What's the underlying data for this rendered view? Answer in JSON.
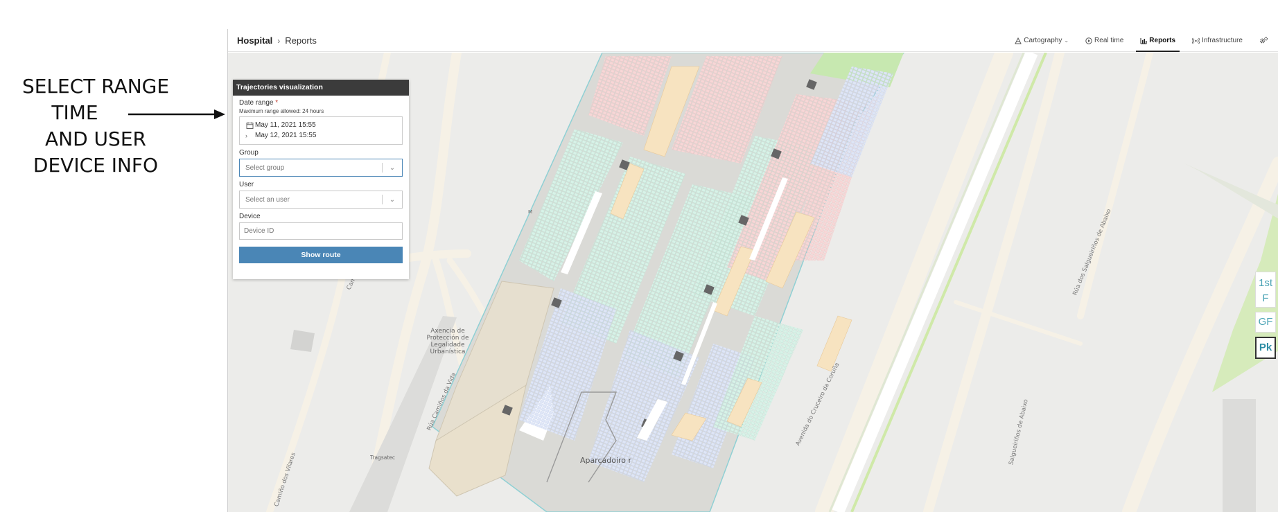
{
  "annotation": {
    "lines": [
      "SELECT RANGE",
      "TIME",
      "AND USER",
      "DEVICE INFO"
    ]
  },
  "breadcrumb": {
    "root": "Hospital",
    "separator": "›",
    "current": "Reports"
  },
  "nav": {
    "items": [
      {
        "label": "Cartography",
        "icon": "map-layers-icon",
        "has_dropdown": true
      },
      {
        "label": "Real time",
        "icon": "play-circle-icon"
      },
      {
        "label": "Reports",
        "icon": "bar-chart-icon",
        "active": true
      },
      {
        "label": "Infrastructure",
        "icon": "signal-icon"
      }
    ],
    "settings_icon": "gears-icon"
  },
  "panel": {
    "title": "Trajectories visualization",
    "date_range_label": "Date range",
    "required_mark": "*",
    "date_hint": "Maximum range allowed: 24 hours",
    "date_from": "May 11, 2021 15:55",
    "date_to": "May 12, 2021 15:55",
    "group_label": "Group",
    "group_placeholder": "Select group",
    "user_label": "User",
    "user_placeholder": "Select an user",
    "device_label": "Device",
    "device_placeholder": "Device ID",
    "submit_label": "Show route"
  },
  "floors": {
    "first_line1": "1st",
    "first_line2": "F",
    "ground": "GF",
    "parking": "Pk",
    "active": "Pk"
  },
  "map_labels": {
    "agency": "Axencia de Protección de Legalidade Urbanística",
    "tragsatec": "Tragsatec",
    "aparcadoiro": "Aparcadoiro r",
    "camino_vilar": "Camiño dos Vilar",
    "camino_vilares": "Camiño dos Vilares",
    "rua_vida": "Rúa Camiños da Vida",
    "avenida": "Avenida do Cruceiro da Coruña",
    "salgueirinos_left": "Salgueiriños de Abaixo",
    "salgueirinos_right": "Rúa dos Salgueiriños de Abaixo",
    "m_label": "M"
  },
  "colors": {
    "accent": "#4a86b6",
    "panel_header": "#3b3b3b",
    "map_bg": "#ececea",
    "floor_text": "#4aa3b5"
  }
}
